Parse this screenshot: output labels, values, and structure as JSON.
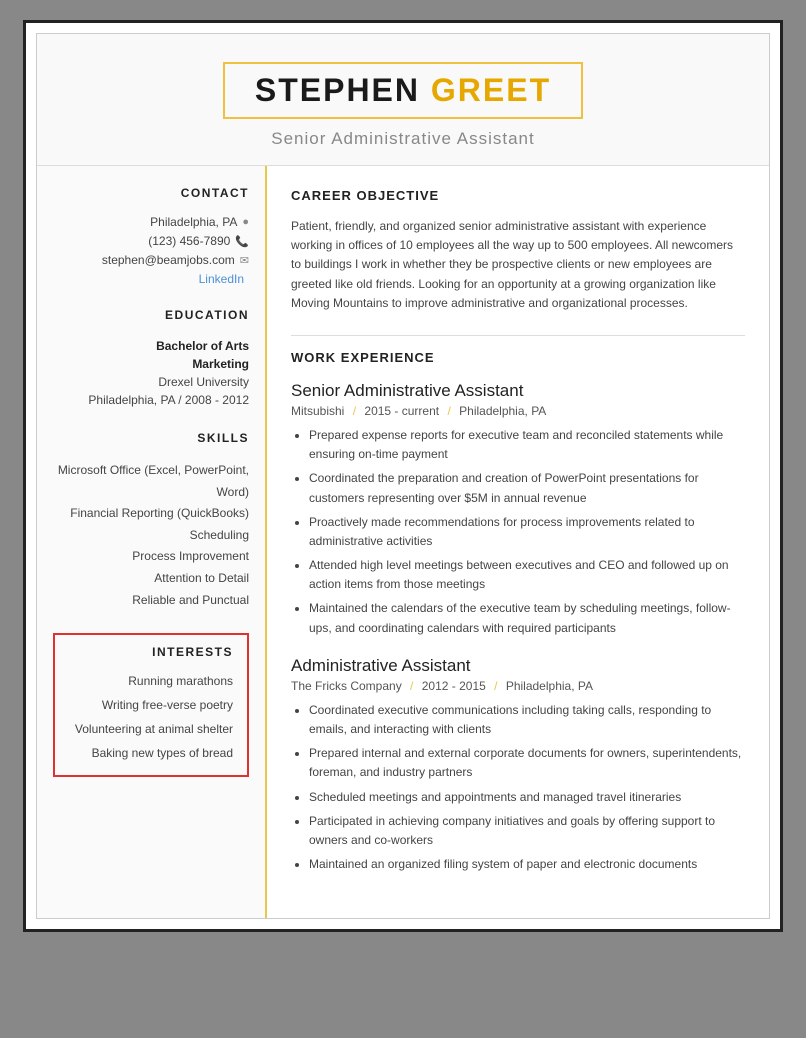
{
  "header": {
    "first_name": "STEPHEN",
    "last_name": "GREET",
    "subtitle": "Senior Administrative Assistant"
  },
  "contact": {
    "section_title": "CONTACT",
    "location": "Philadelphia, PA",
    "phone": "(123) 456-7890",
    "email": "stephen@beamjobs.com",
    "linkedin_label": "LinkedIn"
  },
  "education": {
    "section_title": "EDUCATION",
    "degree": "Bachelor of Arts",
    "field": "Marketing",
    "school": "Drexel University",
    "details": "Philadelphia, PA  /  2008 - 2012"
  },
  "skills": {
    "section_title": "SKILLS",
    "items": [
      "Microsoft Office (Excel, PowerPoint, Word)",
      "Financial Reporting (QuickBooks)",
      "Scheduling",
      "Process Improvement",
      "Attention to Detail",
      "Reliable and Punctual"
    ]
  },
  "interests": {
    "section_title": "INTERESTS",
    "items": [
      "Running marathons",
      "Writing free-verse poetry",
      "Volunteering at animal shelter",
      "Baking new types of bread"
    ]
  },
  "career_objective": {
    "section_title": "CAREER OBJECTIVE",
    "text": "Patient, friendly, and organized senior administrative assistant with experience working in offices of 10 employees all the way up to 500 employees. All newcomers to buildings I work in whether they be prospective clients or new employees are greeted like old friends. Looking for an opportunity at a growing organization like Moving Mountains to improve administrative and organizational processes."
  },
  "work_experience": {
    "section_title": "WORK EXPERIENCE",
    "jobs": [
      {
        "title": "Senior Administrative Assistant",
        "company": "Mitsubishi",
        "period": "2015 - current",
        "location": "Philadelphia, PA",
        "bullets": [
          "Prepared expense reports for executive team and reconciled statements while ensuring on-time payment",
          "Coordinated the preparation and creation of PowerPoint presentations for customers representing over $5M in annual revenue",
          "Proactively made recommendations for process improvements related to administrative activities",
          "Attended high level meetings between executives and CEO and followed up on action items from those meetings",
          "Maintained the calendars of the executive team by scheduling meetings, follow-ups, and coordinating calendars with required participants"
        ]
      },
      {
        "title": "Administrative Assistant",
        "company": "The Fricks Company",
        "period": "2012 - 2015",
        "location": "Philadelphia, PA",
        "bullets": [
          "Coordinated executive communications including taking calls, responding to emails, and interacting with clients",
          "Prepared internal and external corporate documents for owners, superintendents, foreman, and industry partners",
          "Scheduled meetings and appointments and managed travel itineraries",
          "Participated in achieving company initiatives and goals by offering support to owners and co-workers",
          "Maintained an organized filing system of paper and electronic documents"
        ]
      }
    ]
  }
}
